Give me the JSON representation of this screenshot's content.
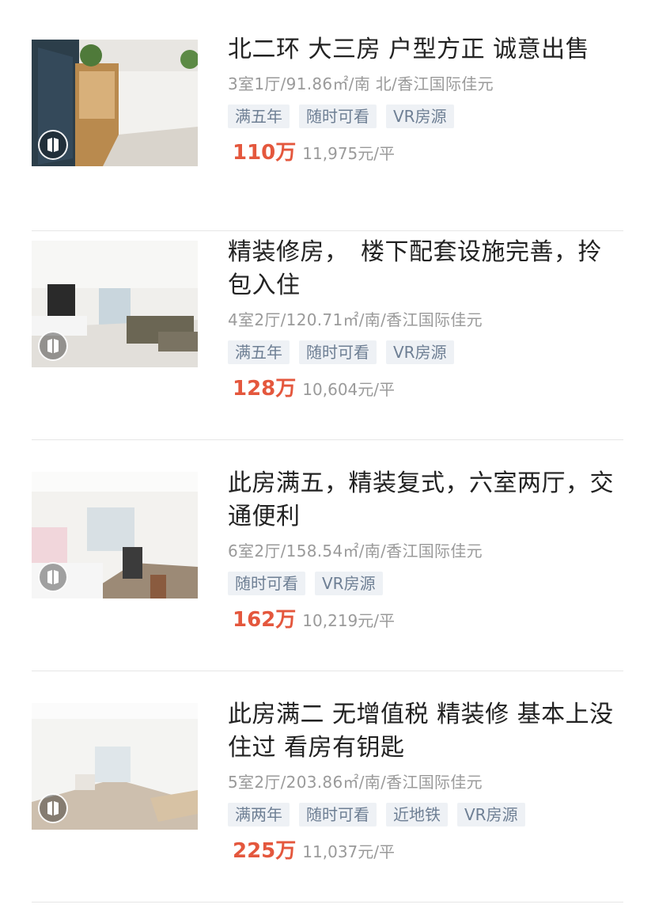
{
  "listings": [
    {
      "title": "北二环 大三房 户型方正 诚意出售",
      "meta": "3室1厅/91.86㎡/南 北/香江国际佳元",
      "tags": [
        "满五年",
        "随时可看",
        "VR房源"
      ],
      "price": "110万",
      "unit_price": "11,975元/平",
      "thumb_icon": "vr-badge-icon"
    },
    {
      "title": "精装修房，　楼下配套设施完善，拎包入住",
      "meta": "4室2厅/120.71㎡/南/香江国际佳元",
      "tags": [
        "满五年",
        "随时可看",
        "VR房源"
      ],
      "price": "128万",
      "unit_price": "10,604元/平",
      "thumb_icon": "vr-badge-icon"
    },
    {
      "title": "此房满五，精装复式，六室两厅，交通便利",
      "meta": "6室2厅/158.54㎡/南/香江国际佳元",
      "tags": [
        "随时可看",
        "VR房源"
      ],
      "price": "162万",
      "unit_price": "10,219元/平",
      "thumb_icon": "vr-badge-icon"
    },
    {
      "title": "此房满二 无增值税 精装修 基本上没住过 看房有钥匙",
      "meta": "5室2厅/203.86㎡/南/香江国际佳元",
      "tags": [
        "满两年",
        "随时可看",
        "近地铁",
        "VR房源"
      ],
      "price": "225万",
      "unit_price": "11,037元/平",
      "thumb_icon": "vr-badge-icon"
    }
  ],
  "colors": {
    "price": "#e4573d",
    "tag_bg": "#eef1f5",
    "tag_text": "#6e7f94",
    "meta": "#9a9a9a"
  }
}
